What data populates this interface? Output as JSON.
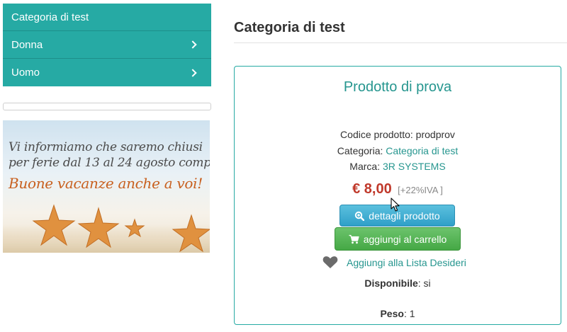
{
  "sidebar": {
    "items": [
      {
        "label": "Categoria di test",
        "has_submenu": false
      },
      {
        "label": "Donna",
        "has_submenu": true
      },
      {
        "label": "Uomo",
        "has_submenu": true
      }
    ]
  },
  "banner": {
    "line1": "Vi informiamo che saremo chiusi",
    "line2": "per ferie dal 13 al 24 agosto compresi.",
    "line3": "Buone vacanze anche a voi!"
  },
  "main": {
    "page_title": "Categoria di test",
    "product": {
      "name": "Prodotto di prova",
      "code_label": "Codice prodotto:",
      "code_value": "prodprov",
      "category_label": "Categoria:",
      "category_value": "Categoria di test",
      "brand_label": "Marca:",
      "brand_value": "3R SYSTEMS",
      "price": "€ 8,00",
      "vat_note": "[+22%IVA ]",
      "details_button": "dettagli prodotto",
      "cart_button": "aggiungi al carrello",
      "wishlist_label": "Aggiungi alla Lista Desideri",
      "availability_label": "Disponibile",
      "availability_value": ": si",
      "weight_label": "Peso",
      "weight_value": ": 1"
    }
  },
  "colors": {
    "accent": "#26aaa4",
    "price": "#c0392b",
    "details_button": "#3aa9d2",
    "cart_button": "#55b555"
  },
  "icons": {
    "submenu": "chevron-right-icon",
    "details": "search-plus-icon",
    "cart": "cart-icon",
    "wishlist": "heart-icon"
  }
}
